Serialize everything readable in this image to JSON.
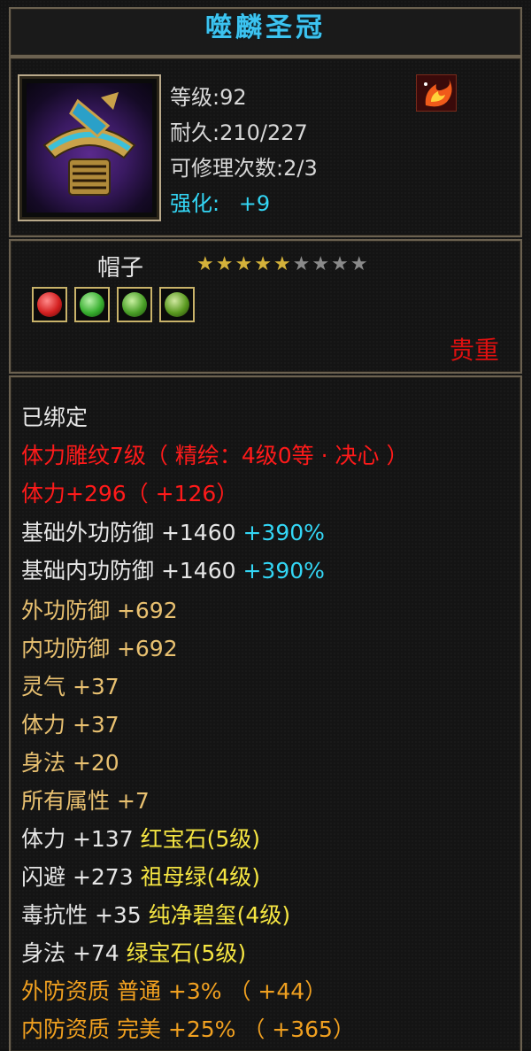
{
  "item": {
    "name": "噬麟圣冠",
    "level": "等级:92",
    "durability": "耐久:210/227",
    "repair": "可修理次数:2/3",
    "enhance_label": "强化:",
    "enhance_value": "+9",
    "type": "帽子",
    "stars_filled": 5,
    "stars_total": 9,
    "rarity": "贵重",
    "icon": "crown-helmet-icon",
    "quality_icon": "phoenix-flame-icon",
    "gems": [
      {
        "icon": "red-gem-icon",
        "color": "#d42020"
      },
      {
        "icon": "green-gem-icon",
        "color": "#38b030"
      },
      {
        "icon": "green-gem-icon",
        "color": "#4aa028"
      },
      {
        "icon": "green-gem-icon",
        "color": "#5a9a20"
      }
    ]
  },
  "attributes": {
    "bound": "已绑定",
    "engrave": "体力雕纹7级（ 精绘：4级0等 · 决心 ）",
    "stamina_main": "体力+296（ +126）",
    "base_ext_def": "基础外功防御 +1460",
    "base_ext_def_pct": "+390%",
    "base_int_def": "基础内功防御 +1460",
    "base_int_def_pct": "+390%",
    "ext_def": "外功防御 +692",
    "int_def": "内功防御 +692",
    "spirit": "灵气 +37",
    "stamina": "体力 +37",
    "agility": "身法 +20",
    "all_attr": "所有属性 +7",
    "gem1_stat": "体力 +137",
    "gem1_name": "红宝石(5级)",
    "gem2_stat": "闪避 +273",
    "gem2_name": "祖母绿(4级)",
    "gem3_stat": "毒抗性 +35",
    "gem3_name": "纯净碧玺(4级)",
    "gem4_stat": "身法 +74",
    "gem4_name": "绿宝石(5级)",
    "ext_apt": "外防资质   普通 +3% （ +44）",
    "int_apt": "内防资质   完美 +25% （ +365）"
  }
}
